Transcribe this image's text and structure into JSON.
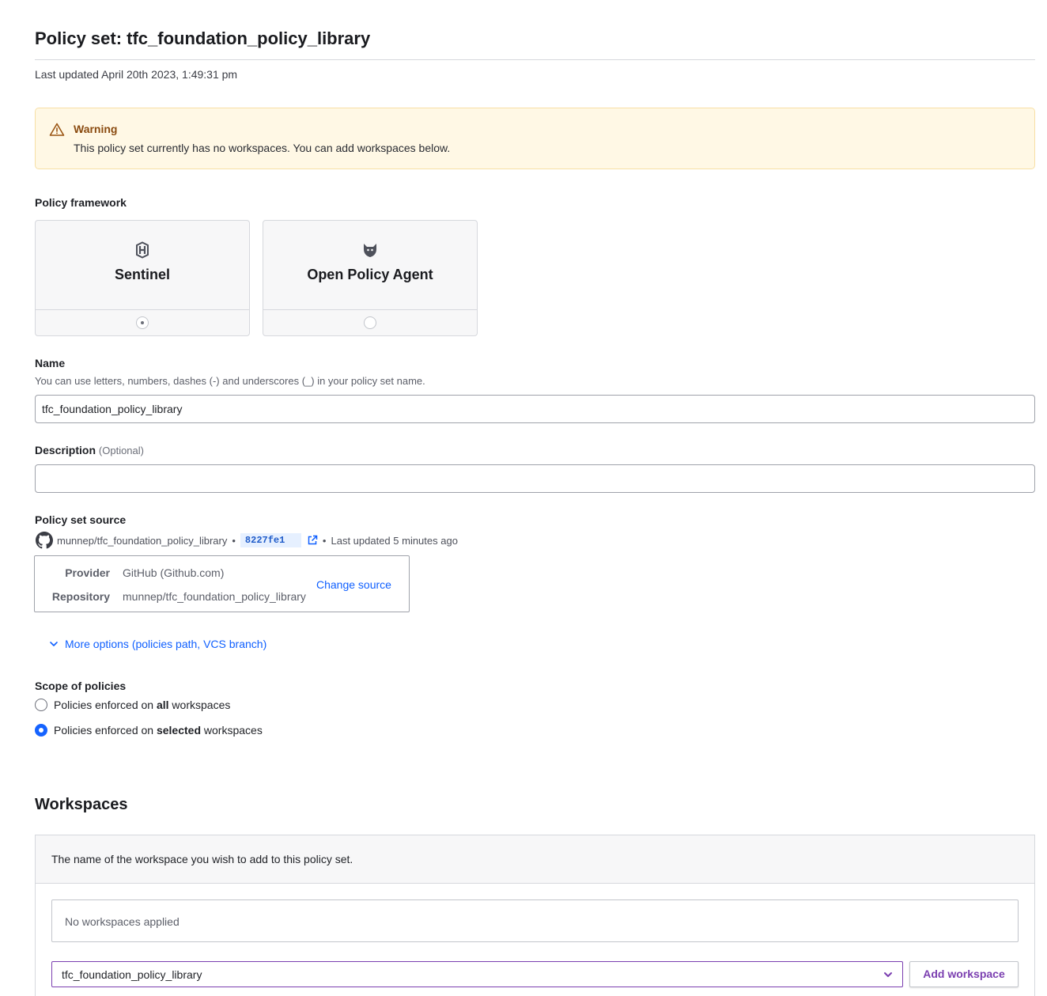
{
  "header": {
    "title": "Policy set: tfc_foundation_policy_library",
    "last_updated": "Last updated April 20th 2023, 1:49:31 pm"
  },
  "warning": {
    "title": "Warning",
    "message": "This policy set currently has no workspaces. You can add workspaces below.",
    "icon": "alert-triangle-icon"
  },
  "framework": {
    "label": "Policy framework",
    "options": [
      {
        "label": "Sentinel",
        "icon": "sentinel-icon",
        "selected": true
      },
      {
        "label": "Open Policy Agent",
        "icon": "opa-icon",
        "selected": false
      }
    ]
  },
  "name": {
    "label": "Name",
    "help": "You can use letters, numbers, dashes (-) and underscores (_) in your policy set name.",
    "value": "tfc_foundation_policy_library"
  },
  "description": {
    "label": "Description",
    "optional": "(Optional)",
    "value": ""
  },
  "source": {
    "label": "Policy set source",
    "repo": "munnep/tfc_foundation_policy_library",
    "commit": "8227fe1",
    "last_updated": "Last updated 5 minutes ago",
    "separator": "•",
    "provider_key": "Provider",
    "provider_value": "GitHub (Github.com)",
    "repository_key": "Repository",
    "repository_value": "munnep/tfc_foundation_policy_library",
    "change_label": "Change source",
    "more_options": "More options (policies path, VCS branch)"
  },
  "scope": {
    "label": "Scope of policies",
    "options": [
      {
        "prefix": "Policies enforced on ",
        "bold": "all",
        "suffix": " workspaces",
        "selected": false
      },
      {
        "prefix": "Policies enforced on ",
        "bold": "selected",
        "suffix": " workspaces",
        "selected": true
      }
    ]
  },
  "workspaces": {
    "title": "Workspaces",
    "hint": "The name of the workspace you wish to add to this policy set.",
    "empty": "No workspaces applied",
    "select_value": "tfc_foundation_policy_library",
    "add_label": "Add workspace"
  },
  "colors": {
    "link": "#1060ff",
    "accent_purple": "#7b3fb0",
    "warning_bg": "#fff8e5",
    "radio_checked": "#1563ff"
  }
}
